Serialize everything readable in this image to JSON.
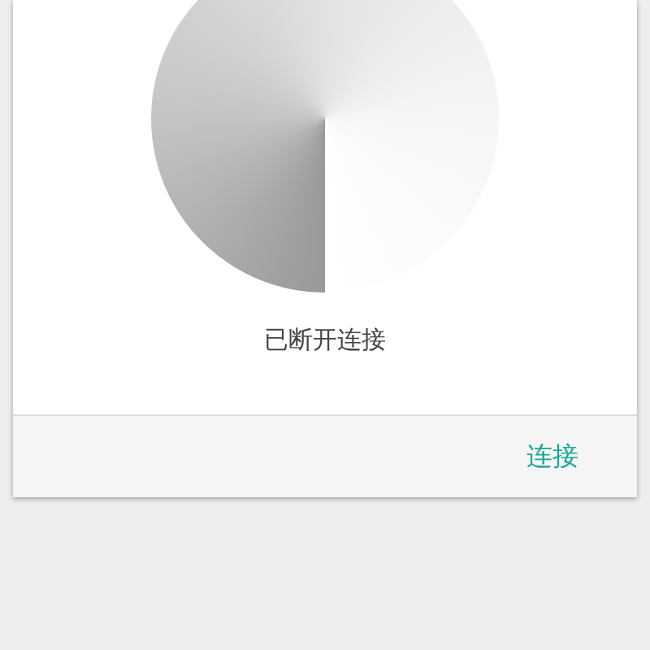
{
  "dialog": {
    "status": "已断开连接",
    "buttons": [
      {
        "label": "连接"
      }
    ]
  }
}
